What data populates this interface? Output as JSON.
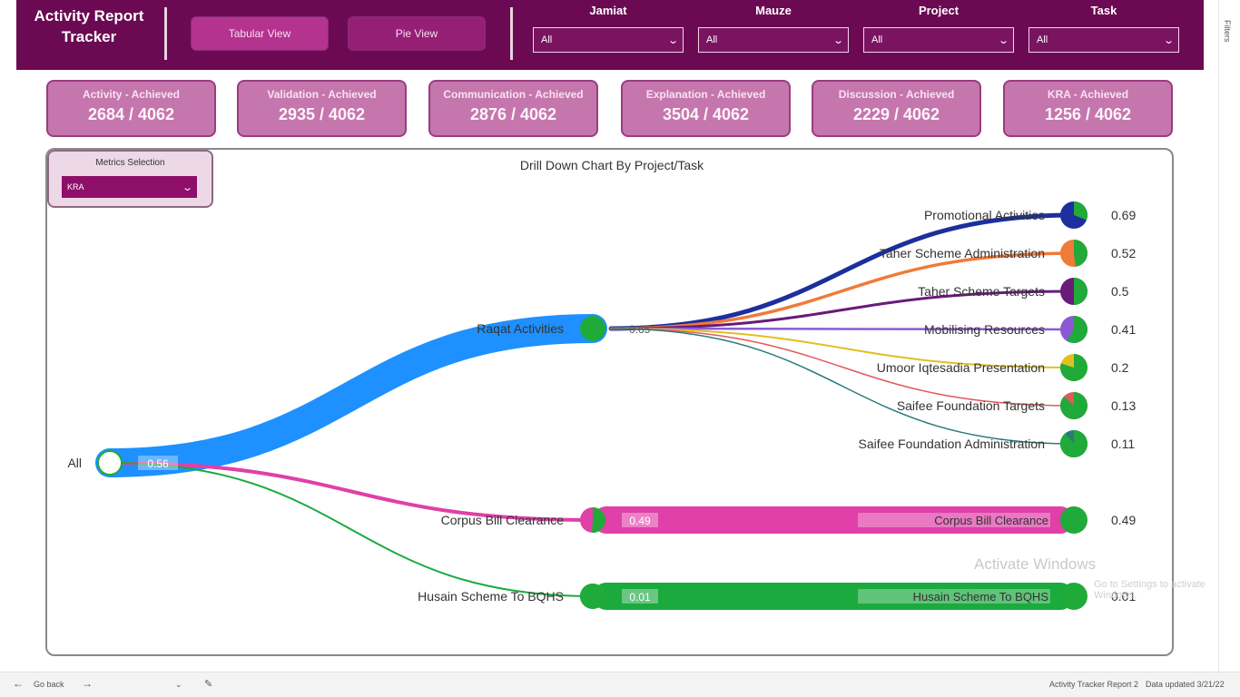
{
  "header": {
    "title": "Activity Report\nTracker",
    "buttons": {
      "tabular": "Tabular View",
      "pie": "Pie View"
    },
    "filters": [
      {
        "label": "Jamiat",
        "value": "All"
      },
      {
        "label": "Mauze",
        "value": "All"
      },
      {
        "label": "Project",
        "value": "All"
      },
      {
        "label": "Task",
        "value": "All"
      }
    ]
  },
  "kpis": [
    {
      "label": "Activity - Achieved",
      "value": "2684 / 4062"
    },
    {
      "label": "Validation - Achieved",
      "value": "2935 / 4062"
    },
    {
      "label": "Communication - Achieved",
      "value": "2876 / 4062"
    },
    {
      "label": "Explanation - Achieved",
      "value": "3504 / 4062"
    },
    {
      "label": "Discussion - Achieved",
      "value": "2229 / 4062"
    },
    {
      "label": "KRA - Achieved",
      "value": "1256 / 4062"
    }
  ],
  "chart": {
    "title": "Drill Down Chart By Project/Task",
    "metrics_selection_label": "Metrics Selection",
    "metrics_selection_value": "KRA"
  },
  "chart_data": {
    "type": "decomposition-tree",
    "root": {
      "label": "All",
      "value": "0.56",
      "color": "#2196f3"
    },
    "level1": [
      {
        "name": "Raqat Activities",
        "value": "0.65",
        "color": "#1e90ff"
      },
      {
        "name": "Corpus Bill Clearance",
        "value": "0.49",
        "color": "#e040a8"
      },
      {
        "name": "Husain Scheme To BQHS",
        "value": "0.01",
        "color": "#1aaa3e"
      }
    ],
    "level2": [
      {
        "name": "Promotional Activities",
        "value": "0.69",
        "parent": "Raqat Activities",
        "color": "#1c2f9c"
      },
      {
        "name": "Taher Scheme Administration",
        "value": "0.52",
        "parent": "Raqat Activities",
        "color": "#f07a3a"
      },
      {
        "name": "Taher Scheme Targets",
        "value": "0.5",
        "parent": "Raqat Activities",
        "color": "#6a1a7a"
      },
      {
        "name": "Mobilising Resources",
        "value": "0.41",
        "parent": "Raqat Activities",
        "color": "#8a5ad6"
      },
      {
        "name": "Umoor Iqtesadia Presentation",
        "value": "0.2",
        "parent": "Raqat Activities",
        "color": "#e0c020"
      },
      {
        "name": "Saifee Foundation Targets",
        "value": "0.13",
        "parent": "Raqat Activities",
        "color": "#e05a5a"
      },
      {
        "name": "Saifee Foundation Administration",
        "value": "0.11",
        "parent": "Raqat Activities",
        "color": "#2a7a7a"
      },
      {
        "name": "Corpus Bill Clearance",
        "value": "0.49",
        "parent": "Corpus Bill Clearance",
        "color": "#e040a8"
      },
      {
        "name": "Husain Scheme To BQHS",
        "value": "0.01",
        "parent": "Husain Scheme To BQHS",
        "color": "#1aaa3e"
      }
    ]
  },
  "watermark": {
    "line1": "Activate Windows",
    "line2": "Go to Settings to activate Windows."
  },
  "right_pane": {
    "filters": "Filters"
  },
  "bottom_bar": {
    "go_back": "Go back",
    "report_name": "Activity Tracker Report 2",
    "data_updated": "Data updated 3/21/22"
  }
}
